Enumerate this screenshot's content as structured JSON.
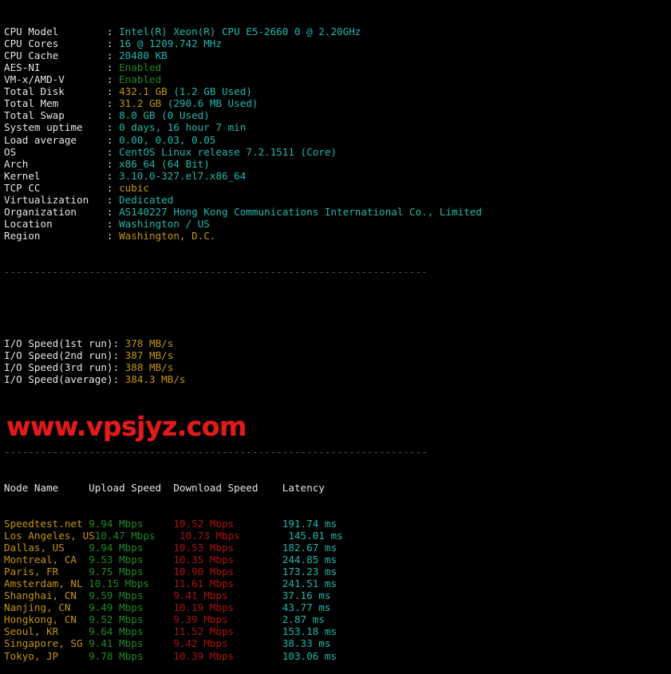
{
  "terminal": {
    "background": "#000000",
    "colors": {
      "label": "#e6e6e6",
      "cyan": "#1fb8ad",
      "green": "#1e8a27",
      "yellow": "#c3960c",
      "red": "#aa1111",
      "separator": "#555555",
      "watermark": "#e01b1b"
    },
    "separator": "----------------------------------------------------------------------",
    "watermark_text": "www.vpsjyz.com"
  },
  "system_info": {
    "rows": [
      {
        "label": "CPU Model",
        "value": "Intel(R) Xeon(R) CPU E5-2660 0 @ 2.20GHz",
        "color": "cyan"
      },
      {
        "label": "CPU Cores",
        "value": "16 @ 1209.742 MHz",
        "color": "cyan"
      },
      {
        "label": "CPU Cache",
        "value": "20480 KB",
        "color": "cyan"
      },
      {
        "label": "AES-NI",
        "value": "Enabled",
        "color": "green"
      },
      {
        "label": "VM-x/AMD-V",
        "value": "Enabled",
        "color": "green"
      },
      {
        "label": "Total Disk",
        "value": "432.1 GB",
        "value2": " (1.2 GB Used)",
        "color": "yellow",
        "color2": "cyan"
      },
      {
        "label": "Total Mem",
        "value": "31.2 GB",
        "value2": " (290.6 MB Used)",
        "color": "yellow",
        "color2": "cyan"
      },
      {
        "label": "Total Swap",
        "value": "8.0 GB (0 Used)",
        "color": "cyan"
      },
      {
        "label": "System uptime",
        "value": "0 days, 16 hour 7 min",
        "color": "cyan"
      },
      {
        "label": "Load average",
        "value": "0.00, 0.03, 0.05",
        "color": "cyan"
      },
      {
        "label": "OS",
        "value": "CentOS Linux release 7.2.1511 (Core)",
        "color": "cyan"
      },
      {
        "label": "Arch",
        "value": "x86_64 (64 Bit)",
        "color": "cyan"
      },
      {
        "label": "Kernel",
        "value": "3.10.0-327.el7.x86_64",
        "color": "cyan"
      },
      {
        "label": "TCP CC",
        "value": "cubic",
        "color": "yellow"
      },
      {
        "label": "Virtualization",
        "value": "Dedicated",
        "color": "cyan"
      },
      {
        "label": "Organization",
        "value": "AS140227 Hong Kong Communications International Co., Limited",
        "color": "cyan"
      },
      {
        "label": "Location",
        "value": "Washington / US",
        "color": "cyan"
      },
      {
        "label": "Region",
        "value": "Washington, D.C.",
        "color": "yellow"
      }
    ]
  },
  "io_speed": {
    "rows": [
      {
        "label": "I/O Speed(1st run)",
        "value": "378 MB/s",
        "color": "yellow"
      },
      {
        "label": "I/O Speed(2nd run)",
        "value": "387 MB/s",
        "color": "yellow"
      },
      {
        "label": "I/O Speed(3rd run)",
        "value": "388 MB/s",
        "color": "yellow"
      },
      {
        "label": "I/O Speed(average)",
        "value": "384.3 MB/s",
        "color": "yellow"
      }
    ]
  },
  "speedtest": {
    "headers": {
      "node": "Node Name",
      "upload": "Upload Speed",
      "download": "Download Speed",
      "latency": "Latency"
    },
    "rows": [
      {
        "node": "Speedtest.net",
        "upload": "9.94 Mbps",
        "download": "10.52 Mbps",
        "latency": "191.74 ms"
      },
      {
        "node": "Los Angeles, US",
        "upload": "10.47 Mbps",
        "download": "10.73 Mbps",
        "latency": "145.01 ms"
      },
      {
        "node": "Dallas, US",
        "upload": "9.94 Mbps",
        "download": "10.53 Mbps",
        "latency": "182.67 ms"
      },
      {
        "node": "Montreal, CA",
        "upload": "9.53 Mbps",
        "download": "10.35 Mbps",
        "latency": "244.85 ms"
      },
      {
        "node": "Paris, FR",
        "upload": "9.75 Mbps",
        "download": "10.90 Mbps",
        "latency": "173.23 ms"
      },
      {
        "node": "Amsterdam, NL",
        "upload": "10.15 Mbps",
        "download": "11.61 Mbps",
        "latency": "241.51 ms"
      },
      {
        "node": "Shanghai, CN",
        "upload": "9.59 Mbps",
        "download": "9.41 Mbps",
        "latency": "37.16 ms"
      },
      {
        "node": "Nanjing, CN",
        "upload": "9.49 Mbps",
        "download": "10.19 Mbps",
        "latency": "43.77 ms"
      },
      {
        "node": "Hongkong, CN",
        "upload": "9.52 Mbps",
        "download": "9.39 Mbps",
        "latency": "2.87 ms"
      },
      {
        "node": "Seoul, KR",
        "upload": "9.64 Mbps",
        "download": "11.52 Mbps",
        "latency": "153.18 ms"
      },
      {
        "node": "Singapore, SG",
        "upload": "9.41 Mbps",
        "download": "9.42 Mbps",
        "latency": "38.33 ms"
      },
      {
        "node": "Tokyo, JP",
        "upload": "9.78 Mbps",
        "download": "10.39 Mbps",
        "latency": "103.06 ms"
      }
    ]
  }
}
